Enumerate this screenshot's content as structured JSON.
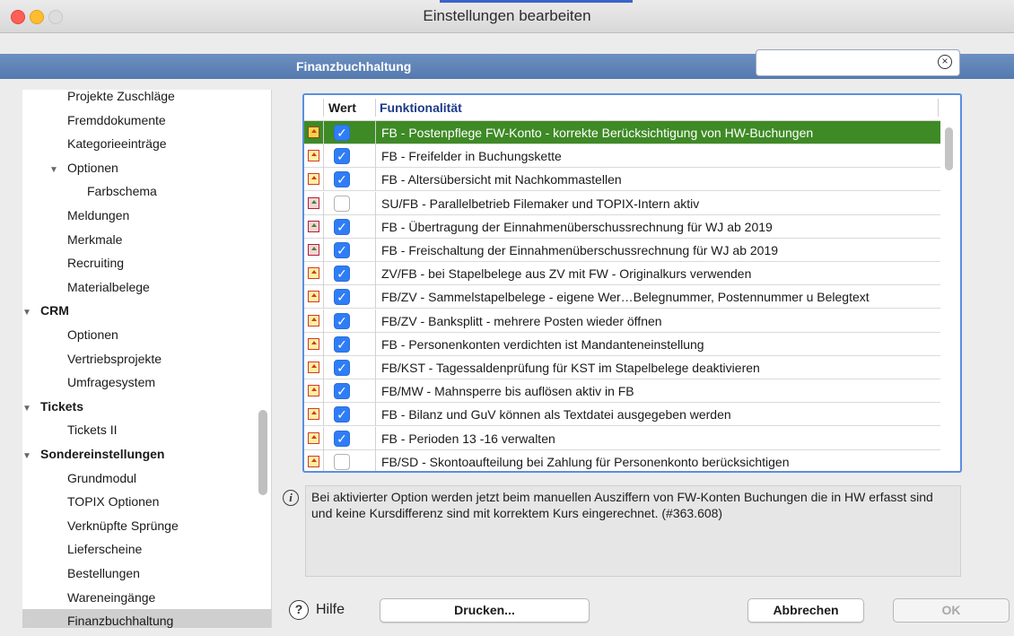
{
  "window": {
    "title": "Einstellungen bearbeiten"
  },
  "section": {
    "title": "Finanzbuchhaltung"
  },
  "search": {
    "value": "",
    "placeholder": ""
  },
  "sidebar": {
    "items": [
      {
        "label": "Projekte Zuschläge",
        "indent": 2,
        "bold": false,
        "selected": false
      },
      {
        "label": "Fremddokumente",
        "indent": 2,
        "bold": false,
        "selected": false
      },
      {
        "label": "Kategorieeinträge",
        "indent": 2,
        "bold": false,
        "selected": false
      },
      {
        "label": "Optionen",
        "indent": 2,
        "bold": false,
        "expander": "▼",
        "selected": false
      },
      {
        "label": "Farbschema",
        "indent": 3,
        "bold": false,
        "selected": false
      },
      {
        "label": "Meldungen",
        "indent": 2,
        "bold": false,
        "selected": false
      },
      {
        "label": "Merkmale",
        "indent": 2,
        "bold": false,
        "selected": false
      },
      {
        "label": "Recruiting",
        "indent": 2,
        "bold": false,
        "selected": false
      },
      {
        "label": "Materialbelege",
        "indent": 2,
        "bold": false,
        "selected": false
      },
      {
        "label": "CRM",
        "indent": 1,
        "bold": true,
        "expander": "▼",
        "selected": false
      },
      {
        "label": "Optionen",
        "indent": 2,
        "bold": false,
        "selected": false
      },
      {
        "label": "Vertriebsprojekte",
        "indent": 2,
        "bold": false,
        "selected": false
      },
      {
        "label": "Umfragesystem",
        "indent": 2,
        "bold": false,
        "selected": false
      },
      {
        "label": "Tickets",
        "indent": 1,
        "bold": true,
        "expander": "▼",
        "selected": false
      },
      {
        "label": "Tickets II",
        "indent": 2,
        "bold": false,
        "selected": false
      },
      {
        "label": "Sondereinstellungen",
        "indent": 1,
        "bold": true,
        "expander": "▼",
        "selected": false
      },
      {
        "label": "Grundmodul",
        "indent": 2,
        "bold": false,
        "selected": false
      },
      {
        "label": "TOPIX Optionen",
        "indent": 2,
        "bold": false,
        "selected": false
      },
      {
        "label": "Verknüpfte Sprünge",
        "indent": 2,
        "bold": false,
        "selected": false
      },
      {
        "label": "Lieferscheine",
        "indent": 2,
        "bold": false,
        "selected": false
      },
      {
        "label": "Bestellungen",
        "indent": 2,
        "bold": false,
        "selected": false
      },
      {
        "label": "Wareneingänge",
        "indent": 2,
        "bold": false,
        "selected": false
      },
      {
        "label": "Finanzbuchhaltung",
        "indent": 2,
        "bold": false,
        "selected": true
      }
    ]
  },
  "table": {
    "headers": {
      "wert": "Wert",
      "funktion": "Funktionalität"
    },
    "rows": [
      {
        "icon": "lock-home-icon",
        "checked": true,
        "text": "FB - Postenpflege FW-Konto - korrekte Berücksichtigung von HW-Buchungen",
        "selected": true
      },
      {
        "icon": "home-icon",
        "checked": true,
        "text": "FB - Freifelder in Buchungskette",
        "selected": false
      },
      {
        "icon": "home-icon",
        "checked": true,
        "text": "FB - Altersübersicht mit Nachkommastellen",
        "selected": false
      },
      {
        "icon": "multi-user-icon",
        "checked": false,
        "text": "SU/FB - Parallelbetrieb Filemaker und TOPIX-Intern aktiv",
        "selected": false
      },
      {
        "icon": "multi-user-icon",
        "checked": true,
        "text": "FB - Übertragung der Einnahmenüberschussrechnung für WJ ab 2019",
        "selected": false
      },
      {
        "icon": "multi-user-icon",
        "checked": true,
        "text": "FB - Freischaltung der Einnahmenüberschussrechnung für WJ ab 2019",
        "selected": false
      },
      {
        "icon": "home-icon",
        "checked": true,
        "text": "ZV/FB - bei Stapelbelege aus ZV mit FW - Originalkurs verwenden",
        "selected": false
      },
      {
        "icon": "home-icon",
        "checked": true,
        "text": "FB/ZV - Sammelstapelbelege - eigene Wer…Belegnummer, Postennummer u Belegtext",
        "selected": false
      },
      {
        "icon": "home-icon",
        "checked": true,
        "text": "FB/ZV - Banksplitt - mehrere Posten wieder öffnen",
        "selected": false
      },
      {
        "icon": "home-icon",
        "checked": true,
        "text": "FB - Personenkonten verdichten ist Mandanteneinstellung",
        "selected": false
      },
      {
        "icon": "home-icon",
        "checked": true,
        "text": "FB/KST - Tagessaldenprüfung für KST im Stapelbelege deaktivieren",
        "selected": false
      },
      {
        "icon": "home-icon",
        "checked": true,
        "text": "FB/MW - Mahnsperre bis auflösen aktiv in FB",
        "selected": false
      },
      {
        "icon": "home-icon",
        "checked": true,
        "text": "FB - Bilanz und GuV können als Textdatei ausgegeben werden",
        "selected": false
      },
      {
        "icon": "home-icon",
        "checked": true,
        "text": "FB - Perioden 13 -16 verwalten",
        "selected": false
      },
      {
        "icon": "home-icon",
        "checked": false,
        "text": "FB/SD - Skontoaufteilung bei Zahlung für Personenkonto berücksichtigen",
        "selected": false
      }
    ]
  },
  "info": {
    "text": "Bei aktivierter Option werden jetzt beim manuellen Ausziffern von FW-Konten Buchungen die in HW erfasst sind und keine Kursdifferenz sind mit korrektem Kurs eingerechnet. (#363.608)"
  },
  "buttons": {
    "help": "Hilfe",
    "print": "Drucken...",
    "cancel": "Abbrechen",
    "ok": "OK"
  },
  "colors": {
    "section_bar": "#5f84b8",
    "selected_row": "#3e8a25",
    "checkbox_on": "#2f7df6",
    "table_focus_border": "#5a8fe0"
  }
}
